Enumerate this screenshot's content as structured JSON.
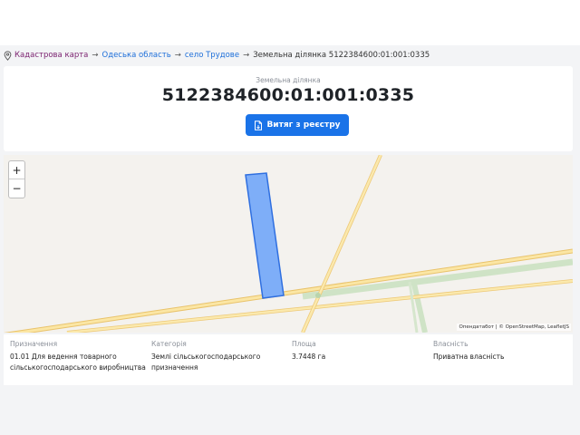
{
  "breadcrumb": {
    "home": "Кадастрова карта",
    "sep": "→",
    "region": "Одеська область",
    "village": "село Трудове",
    "current": "Земельна ділянка 5122384600:01:001:0335"
  },
  "header": {
    "label": "Земельна ділянка",
    "title": "5122384600:01:001:0335",
    "button_label": "Витяг з реєстру"
  },
  "map": {
    "zoom_in": "+",
    "zoom_out": "−",
    "attribution": "Опендатабот | © OpenStreetMap, LeafletJS",
    "parcel_color": "#7eaef8",
    "parcel_border": "#2f6fe0"
  },
  "info": {
    "purpose_label": "Призначення",
    "purpose_value": "01.01 Для ведення товарного сільськогосподарського виробництва",
    "category_label": "Категорія",
    "category_value": "Землі сільськогосподарського призначення",
    "area_label": "Площа",
    "area_value": "3.7448 га",
    "ownership_label": "Власність",
    "ownership_value": "Приватна власність"
  },
  "colors": {
    "accent": "#1a73e8",
    "home_link": "#7a1f6e",
    "link": "#1e6fd9"
  }
}
